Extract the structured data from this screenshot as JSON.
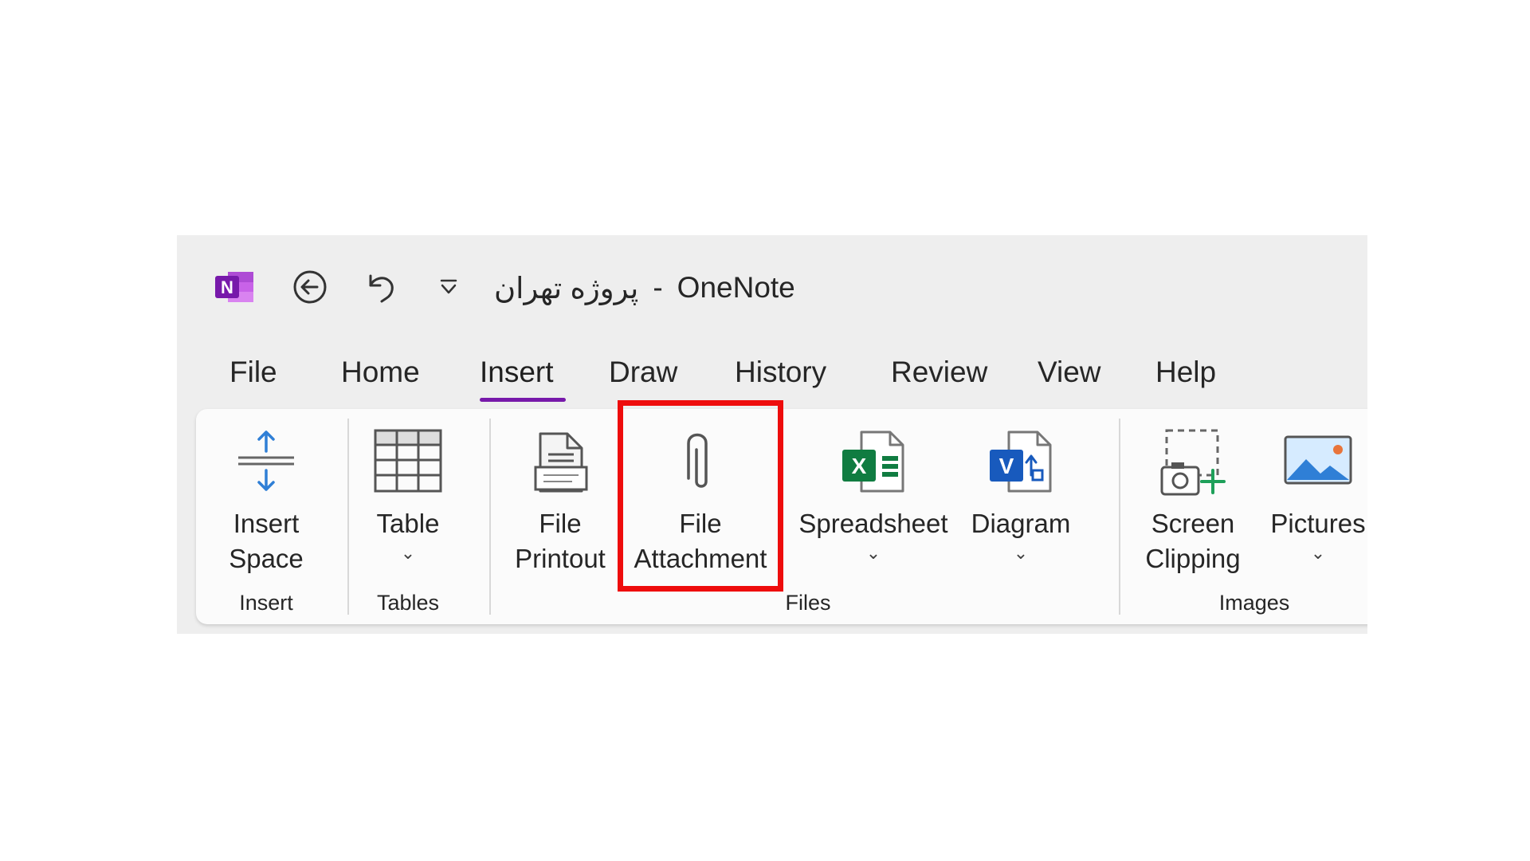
{
  "titlebar": {
    "doc_name": "پروژه تهران",
    "separator": "-",
    "app_name": "OneNote"
  },
  "tabs": [
    {
      "label": "File"
    },
    {
      "label": "Home"
    },
    {
      "label": "Insert"
    },
    {
      "label": "Draw"
    },
    {
      "label": "History"
    },
    {
      "label": "Review"
    },
    {
      "label": "View"
    },
    {
      "label": "Help"
    }
  ],
  "active_tab": "Insert",
  "ribbon": {
    "commands": {
      "insert_space": {
        "line1": "Insert",
        "line2": "Space"
      },
      "table": {
        "line1": "Table"
      },
      "file_printout": {
        "line1": "File",
        "line2": "Printout"
      },
      "file_attachment": {
        "line1": "File",
        "line2": "Attachment"
      },
      "spreadsheet": {
        "line1": "Spreadsheet"
      },
      "diagram": {
        "line1": "Diagram"
      },
      "screen_clipping": {
        "line1": "Screen",
        "line2": "Clipping"
      },
      "pictures": {
        "line1": "Pictures"
      }
    },
    "groups": {
      "insert": "Insert",
      "tables": "Tables",
      "files": "Files",
      "images": "Images"
    }
  },
  "icons": {
    "logo_glyph": "N",
    "spreadsheet_glyph": "X",
    "diagram_glyph": "V",
    "chevron": "⌄"
  },
  "colors": {
    "accent_tab_underline": "#7719aa",
    "highlight_border": "#ee0c0c",
    "onenote_purple": "#7719aa",
    "excel_green": "#107c41",
    "visio_blue": "#185abd",
    "icon_blue": "#2f7fd6"
  }
}
